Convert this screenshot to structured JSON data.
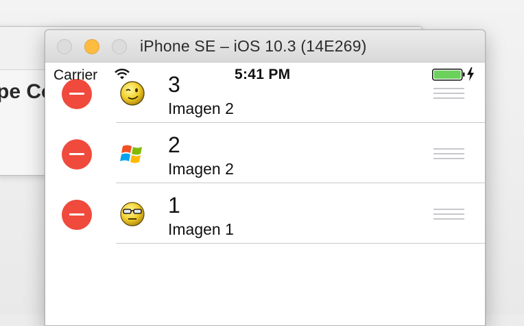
{
  "background_window": {
    "partial_heading": "pe Co"
  },
  "simulator": {
    "title": "iPhone SE – iOS 10.3 (14E269)"
  },
  "status_bar": {
    "carrier": "Carrier",
    "time": "5:41 PM",
    "battery_color": "#6bd15c"
  },
  "table": {
    "rows": [
      {
        "title": "3",
        "subtitle": "Imagen 2",
        "icon": "wink-smiley-icon"
      },
      {
        "title": "2",
        "subtitle": "Imagen 2",
        "icon": "windows-logo-icon"
      },
      {
        "title": "1",
        "subtitle": "Imagen 1",
        "icon": "glasses-smiley-icon"
      }
    ]
  },
  "colors": {
    "delete": "#ef4a3c",
    "separator": "#c8c7cc",
    "minimize_button": "#fdbc40"
  }
}
